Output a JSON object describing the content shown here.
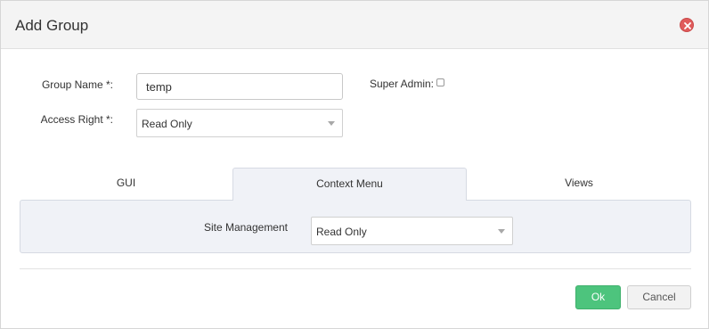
{
  "dialog": {
    "title": "Add Group"
  },
  "form": {
    "group_name_label": "Group Name *:",
    "group_name_value": "temp",
    "access_right_label": "Access Right *:",
    "access_right_value": "Read Only",
    "super_admin_label": "Super Admin:",
    "super_admin_checked": false
  },
  "tabs": [
    {
      "label": "GUI",
      "active": false
    },
    {
      "label": "Context Menu",
      "active": true
    },
    {
      "label": "Views",
      "active": false
    }
  ],
  "panel": {
    "site_management_label": "Site Management",
    "site_management_value": "Read Only"
  },
  "footer": {
    "ok_label": "Ok",
    "cancel_label": "Cancel"
  },
  "colors": {
    "ok_button": "#4dc47d",
    "close_icon": "#e05b5b",
    "active_tab_bg": "#f0f2f7"
  }
}
